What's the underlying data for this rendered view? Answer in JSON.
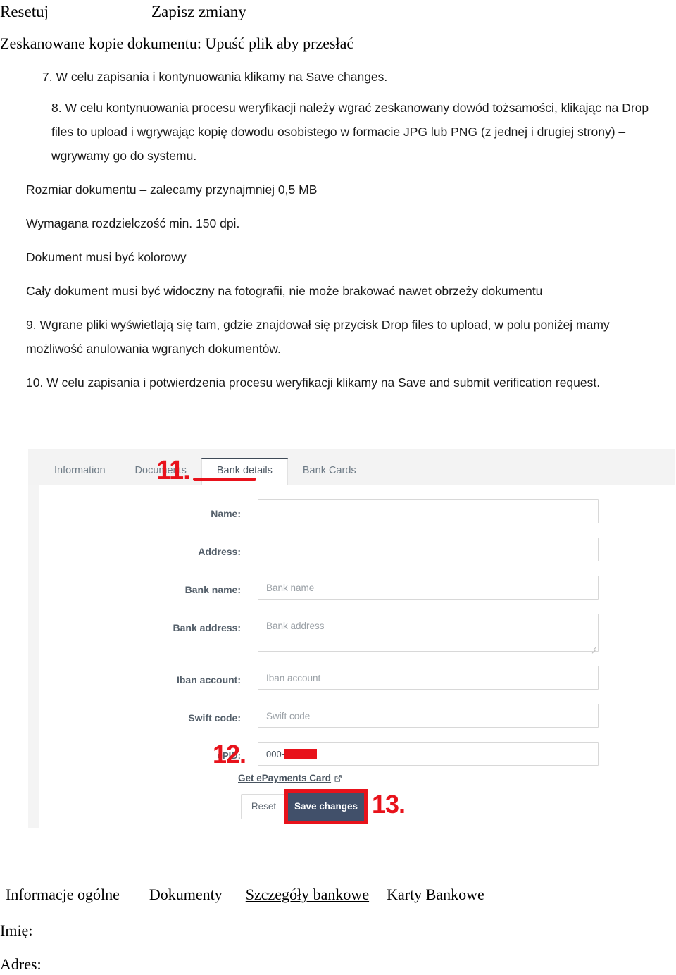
{
  "document": {
    "header": {
      "reset_label": "Resetuj",
      "save_label": "Zapisz zmiany"
    },
    "scanned_copies_line": "Zeskanowane kopie dokumentu: Upuść plik aby przesłać",
    "instructions": [
      "7. W celu zapisania i kontynuowania klikamy na Save changes.",
      "8. W celu kontynuowania procesu weryfikacji należy wgrać zeskanowany dowód tożsamości, klikając na Drop files to upload i wgrywając kopię dowodu osobistego w formacie JPG lub PNG (z jednej i drugiej strony) – wgrywamy go do systemu.",
      "Rozmiar dokumentu – zalecamy przynajmniej 0,5 MB",
      "Wymagana rozdzielczość  min. 150 dpi.",
      "Dokument musi być kolorowy",
      "Cały dokument musi być widoczny na fotografii, nie może brakować nawet obrzeży dokumentu",
      "9. Wgrane pliki wyświetlają się tam, gdzie znajdował się przycisk Drop files to upload, w polu poniżej mamy możliwość anulowania wgranych dokumentów.",
      "10. W celu zapisania i potwierdzenia procesu weryfikacji klikamy na Save and submit verification request."
    ],
    "bottom_glossary": {
      "tab_information": "Informacje ogólne",
      "tab_documents": "Dokumenty",
      "tab_bank_details": "Szczegóły bankowe",
      "tab_bank_cards": "Karty Bankowe",
      "field_name_label": "Imię:",
      "field_address_label": "Adres:"
    }
  },
  "annotations": {
    "step_11": "11.",
    "step_12": "12.",
    "step_13": "13.",
    "highlight_color": "#e8121b"
  },
  "embedded_app": {
    "tabs": [
      {
        "label": "Information",
        "active": false
      },
      {
        "label": "Documents",
        "active": false
      },
      {
        "label": "Bank details",
        "active": true
      },
      {
        "label": "Bank Cards",
        "active": false
      }
    ],
    "form": {
      "fields": [
        {
          "label": "Name:",
          "value": "",
          "placeholder": ""
        },
        {
          "label": "Address:",
          "value": "",
          "placeholder": ""
        },
        {
          "label": "Bank name:",
          "value": "",
          "placeholder": "Bank name"
        },
        {
          "label": "Bank address:",
          "value": "",
          "placeholder": "Bank address"
        },
        {
          "label": "Iban account:",
          "value": "",
          "placeholder": "Iban account"
        },
        {
          "label": "Swift code:",
          "value": "",
          "placeholder": "Swift code"
        }
      ],
      "epid": {
        "label": "ePID:",
        "value_prefix": "000-",
        "value_redacted": true
      },
      "epayments_link": "Get ePayments Card",
      "reset_button": "Reset",
      "save_button": "Save changes",
      "save_button_color": "#41506a"
    }
  }
}
